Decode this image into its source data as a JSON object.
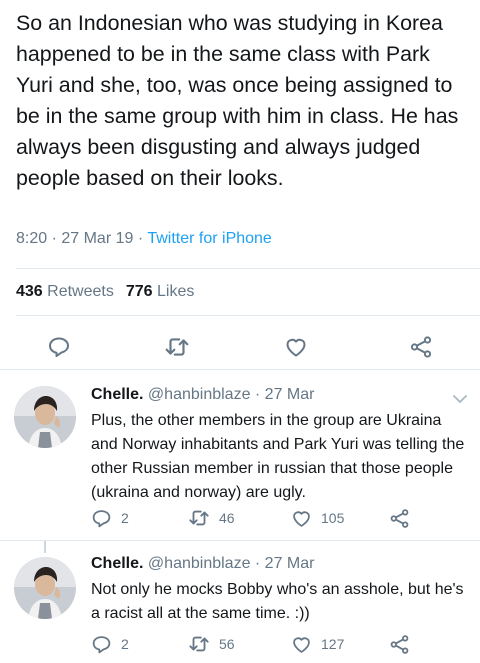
{
  "tweet": {
    "text": "So an Indonesian who was studying in Korea happened to be in the same class with Park Yuri and she, too, was once being assigned to be in the same group with him in class. He has always been disgusting and always judged people based on their looks.",
    "time": "8:20 · 27 Mar 19 · ",
    "client": "Twitter for iPhone",
    "retweets_count": "436",
    "retweets_label": "Retweets",
    "likes_count": "776",
    "likes_label": "Likes"
  },
  "actions": [
    "reply-icon",
    "retweet-icon",
    "like-icon",
    "share-icon"
  ],
  "replies": [
    {
      "name": "Chelle.",
      "handle_date": "@hanbinblaze · 27 Mar",
      "text": "Plus, the other members in the group are Ukraina and Norway inhabitants and Park Yuri was telling the other Russian member in russian that those people (ukraina and norway) are ugly.",
      "replies": "2",
      "retweets": "46",
      "likes": "105"
    },
    {
      "name": "Chelle.",
      "handle_date": "@hanbinblaze · 27 Mar",
      "text": "Not only he mocks Bobby who's an asshole, but he's a racist all at the same time. :))",
      "replies": "2",
      "retweets": "56",
      "likes": "127"
    }
  ],
  "colors": {
    "text": "#14171a",
    "muted": "#657786",
    "link": "#1da1f2",
    "divider": "#e1e8ed"
  }
}
